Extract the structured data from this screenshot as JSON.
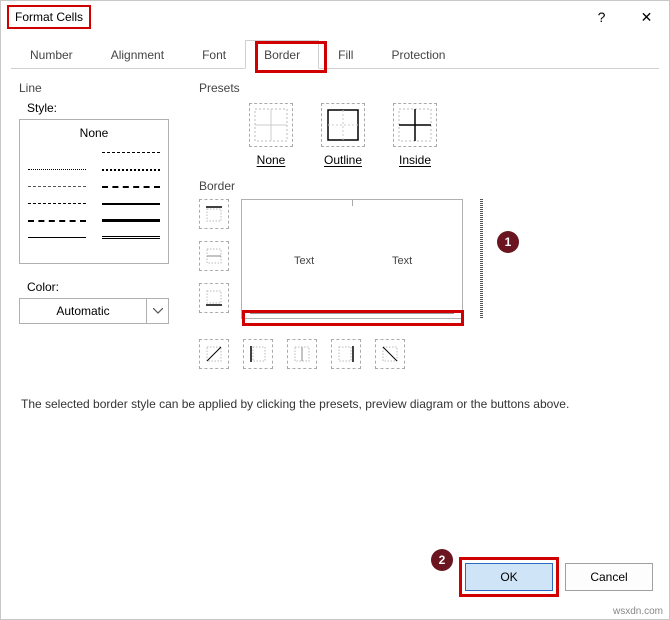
{
  "window": {
    "title": "Format Cells",
    "help_icon": "?",
    "close_icon": "✕"
  },
  "tabs": {
    "number": "Number",
    "alignment": "Alignment",
    "font": "Font",
    "border": "Border",
    "fill": "Fill",
    "protection": "Protection"
  },
  "line": {
    "group": "Line",
    "style_label": "Style:",
    "none": "None",
    "color_label": "Color:",
    "color_value": "Automatic"
  },
  "presets": {
    "group": "Presets",
    "none": "None",
    "outline": "Outline",
    "inside": "Inside"
  },
  "border": {
    "group": "Border",
    "text1": "Text",
    "text2": "Text"
  },
  "help_text": "The selected border style can be applied by clicking the presets, preview diagram or the buttons above.",
  "buttons": {
    "ok": "OK",
    "cancel": "Cancel"
  },
  "badges": {
    "b1": "1",
    "b2": "2"
  },
  "watermark": "wsxdn.com"
}
